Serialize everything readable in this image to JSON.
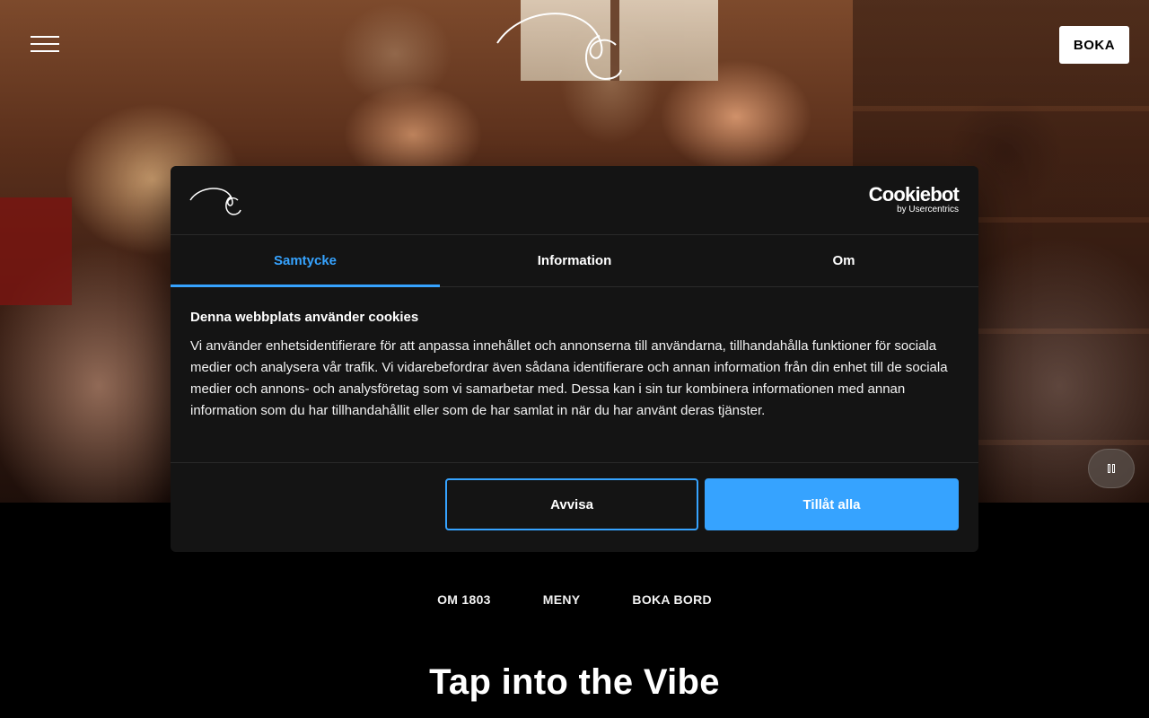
{
  "header": {
    "menu_icon": "hamburger-menu-icon",
    "logo_icon": "script-c-logo",
    "book_label": "BOKA"
  },
  "hero": {
    "pause_icon": "pause-icon"
  },
  "cookie_dialog": {
    "logo_icon": "script-c-logo",
    "brand_name": "Cookiebot",
    "brand_by": "by Usercentrics",
    "tabs": [
      {
        "label": "Samtycke",
        "active": true
      },
      {
        "label": "Information",
        "active": false
      },
      {
        "label": "Om",
        "active": false
      }
    ],
    "heading": "Denna webbplats använder cookies",
    "body": "Vi använder enhetsidentifierare för att anpassa innehållet och annonserna till användarna, tillhandahålla funktioner för sociala medier och analysera vår trafik. Vi vidarebefordrar även sådana identifierare och annan information från din enhet till de sociala medier och annons- och analysföretag som vi samarbetar med. Dessa kan i sin tur kombinera informationen med annan information som du har tillhandahållit eller som de har samlat in när du har använt deras tjänster.",
    "decline_label": "Avvisa",
    "accept_label": "Tillåt alla",
    "accent_color": "#36a3ff"
  },
  "nav": {
    "items": [
      {
        "label": "OM 1803"
      },
      {
        "label": "MENY"
      },
      {
        "label": "BOKA BORD"
      }
    ]
  },
  "tagline": "Tap into the Vibe"
}
